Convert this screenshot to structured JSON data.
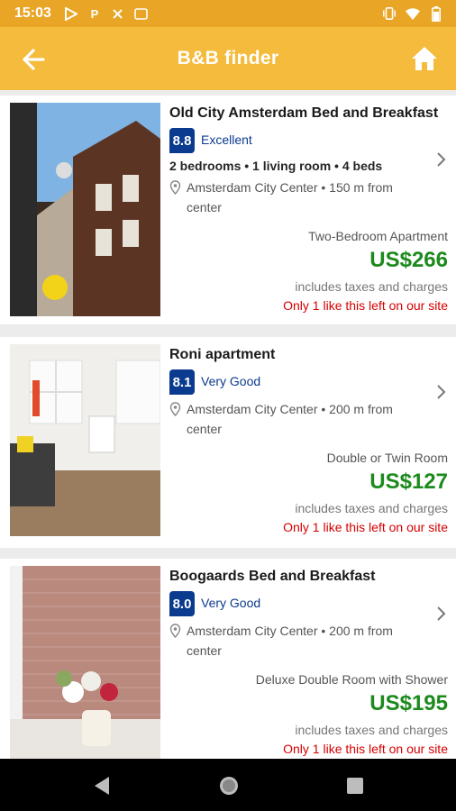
{
  "status_bar": {
    "time": "15:03"
  },
  "app_bar": {
    "title": "B&B finder"
  },
  "colors": {
    "status_bar": "#e8a526",
    "app_bar": "#f4bb3c",
    "score_badge": "#0b3b8e",
    "price": "#1c8a1c",
    "availability": "#d60000"
  },
  "listings": [
    {
      "name": "Old City Amsterdam Bed and Breakfast",
      "score": "8.8",
      "score_label": "Excellent",
      "rooms": "2 bedrooms • 1 living room • 4 beds",
      "location": "Amsterdam City Center • 150 m from center",
      "room_type": "Two-Bedroom Apartment",
      "price": "US$266",
      "taxes": "includes taxes and charges",
      "availability": "Only 1 like this left on our site"
    },
    {
      "name": "Roni apartment",
      "score": "8.1",
      "score_label": "Very Good",
      "location": "Amsterdam City Center • 200 m from center",
      "room_type": "Double or Twin Room",
      "price": "US$127",
      "taxes": "includes taxes and charges",
      "availability": "Only 1 like this left on our site"
    },
    {
      "name": "Boogaards Bed and Breakfast",
      "score": "8.0",
      "score_label": "Very Good",
      "location": "Amsterdam City Center • 200 m from center",
      "room_type": "Deluxe Double Room with Shower",
      "price": "US$195",
      "taxes": "includes taxes and charges",
      "availability": "Only 1 like this left on our site"
    }
  ]
}
